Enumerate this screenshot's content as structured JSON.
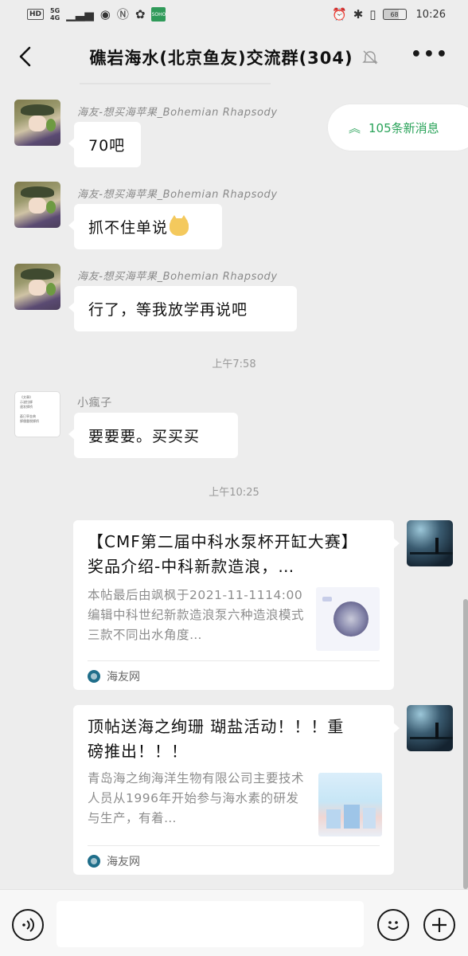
{
  "status_bar": {
    "hd": "HD",
    "signal": "5G",
    "signal_sub": "4G",
    "green_app": "SOHO",
    "battery": "68",
    "time": "10:26"
  },
  "header": {
    "title": "礁岩海水(北京鱼友)交流群(304)"
  },
  "new_messages": {
    "label": "105条新消息"
  },
  "messages": [
    {
      "sender": "海友-想买海苹果_Bohemian Rhapsody",
      "text": "70吧"
    },
    {
      "sender": "海友-想买海苹果_Bohemian Rhapsody",
      "text": "抓不住单说"
    },
    {
      "sender": "海友-想买海苹果_Bohemian Rhapsody",
      "text": "行了，等我放学再说吧"
    },
    {
      "sender": "小瘋子",
      "text": "要要要。买买买"
    }
  ],
  "timestamps": [
    "上午7:58",
    "上午10:25"
  ],
  "doc_avatar_lines": [
    "《文章》",
    "示波拉柳",
    "速发掷桥",
    "",
    "蒼巳亭金典",
    "掷僵重税掷桥"
  ],
  "cards": [
    {
      "title": "【CMF第二届中科水泵杯开缸大赛】奖品介绍-中科新款造浪，…",
      "description": "本帖最后由飒枫于2021-11-1114:00编辑中科世纪新款造浪泵六种造浪模式三款不同出水角度…",
      "source": "海友网"
    },
    {
      "title": "顶帖送海之绚珊 瑚盐活动！！！重磅推出！！！",
      "description": "青岛海之绚海洋生物有限公司主要技术人员从1996年开始参与海水素的研发与生产，有着…",
      "source": "海友网"
    }
  ],
  "input": {
    "value": ""
  }
}
